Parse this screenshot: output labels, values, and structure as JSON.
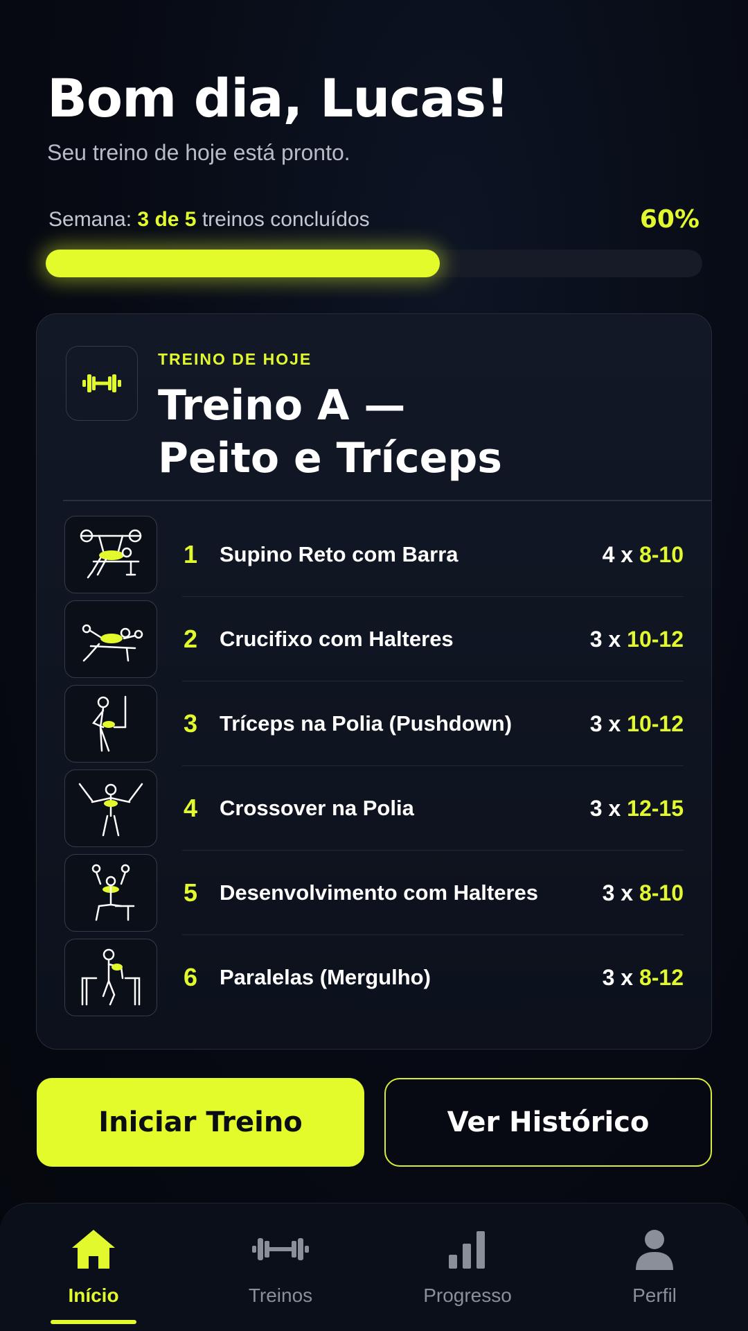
{
  "header": {
    "greeting": "Bom dia, Lucas!",
    "subtitle": "Seu treino de hoje está pronto."
  },
  "progress": {
    "prefix": "Semana:",
    "highlight": "3 de 5",
    "suffix": "treinos concluídos",
    "percent_label": "60%",
    "completed": 3,
    "total": 5,
    "fraction": 0.6
  },
  "today_card": {
    "label": "TREINO DE HOJE",
    "title_line1": "Treino A —",
    "title_line2": "Peito e Tríceps",
    "icon": "dumbbell-icon",
    "exercises": [
      {
        "number": "1",
        "name": "Supino Reto com Barra",
        "sets": "4",
        "reps": "8-10",
        "icon": "bench-press-icon"
      },
      {
        "number": "2",
        "name": "Crucifixo com Halteres",
        "sets": "3",
        "reps": "10-12",
        "icon": "dumbbell-fly-icon"
      },
      {
        "number": "3",
        "name": "Tríceps na Polia (Pushdown)",
        "sets": "3",
        "reps": "10-12",
        "icon": "triceps-pushdown-icon"
      },
      {
        "number": "4",
        "name": "Crossover na Polia",
        "sets": "3",
        "reps": "12-15",
        "icon": "cable-crossover-icon"
      },
      {
        "number": "5",
        "name": "Desenvolvimento com Halteres",
        "sets": "3",
        "reps": "8-10",
        "icon": "shoulder-press-icon"
      },
      {
        "number": "6",
        "name": "Paralelas (Mergulho)",
        "sets": "3",
        "reps": "8-12",
        "icon": "dips-icon"
      }
    ]
  },
  "actions": {
    "start_label": "Iniciar Treino",
    "history_label": "Ver Histórico"
  },
  "tabbar": {
    "items": [
      {
        "label": "Início",
        "icon": "home-icon",
        "active": true
      },
      {
        "label": "Treinos",
        "icon": "dumbbell-icon",
        "active": false
      },
      {
        "label": "Progresso",
        "icon": "bar-chart-icon",
        "active": false
      },
      {
        "label": "Perfil",
        "icon": "person-icon",
        "active": false
      }
    ]
  },
  "colors": {
    "accent": "#e3fb2b",
    "background": "#070a13",
    "card": "#121826",
    "muted": "#8a8f99"
  }
}
